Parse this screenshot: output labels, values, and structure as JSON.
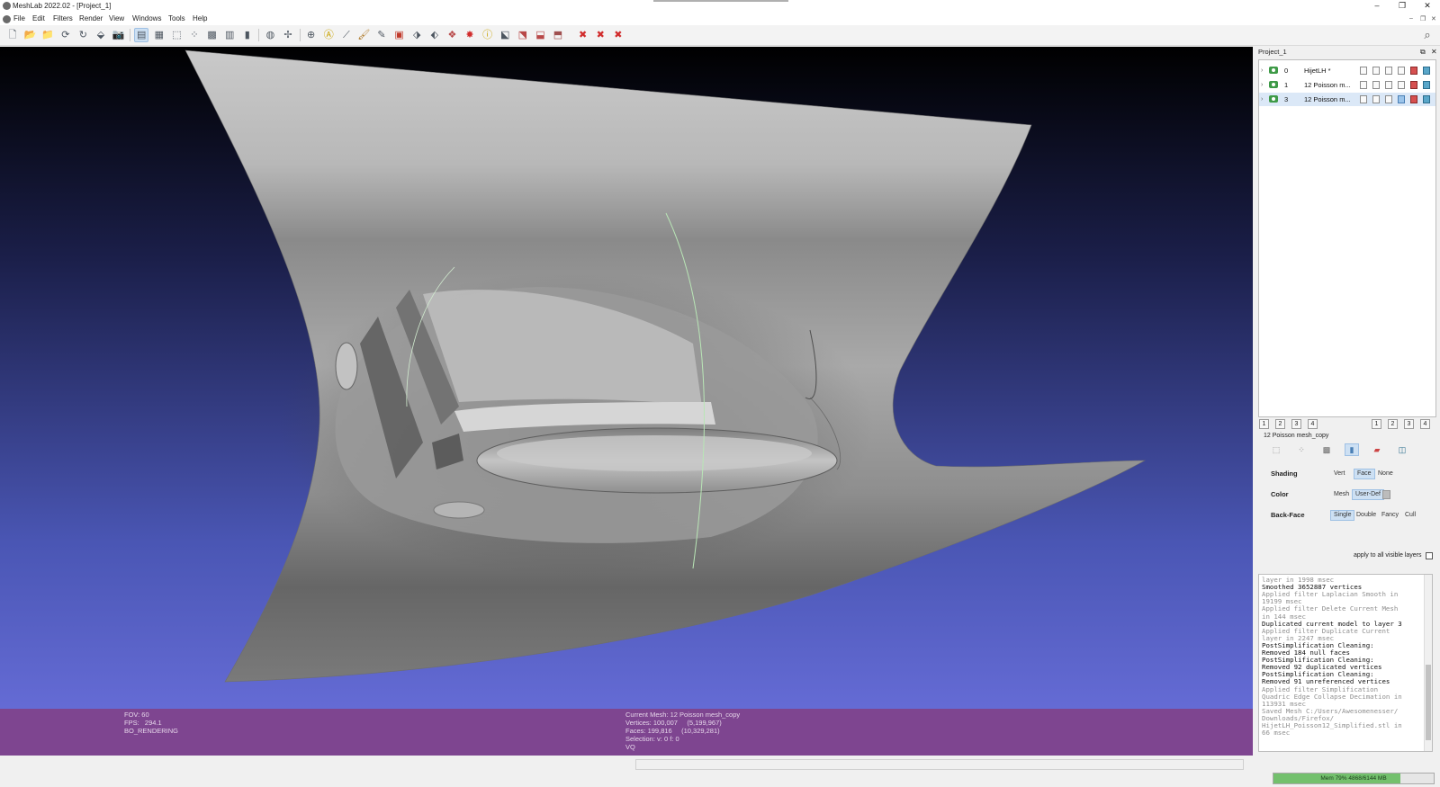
{
  "window": {
    "title": "MeshLab 2022.02 - [Project_1]",
    "controls": [
      "–",
      "❐",
      "✕"
    ]
  },
  "menu": [
    "File",
    "Edit",
    "Filters",
    "Render",
    "View",
    "Windows",
    "Tools",
    "Help"
  ],
  "toolbar": {
    "buttons": [
      {
        "name": "new-project-icon",
        "glyph": "🗋",
        "active": false
      },
      {
        "name": "open-project-icon",
        "glyph": "📂",
        "active": false
      },
      {
        "name": "import-mesh-icon",
        "glyph": "📁",
        "active": false
      },
      {
        "name": "reload-icon",
        "glyph": "⟳",
        "active": false
      },
      {
        "name": "reload-all-icon",
        "glyph": "↻",
        "active": false
      },
      {
        "name": "export-mesh-icon",
        "glyph": "⬙",
        "active": false
      },
      {
        "name": "snapshot-icon",
        "glyph": "📷",
        "active": false
      },
      {
        "name": "show-layers-icon",
        "glyph": "▤",
        "active": true
      },
      {
        "name": "raster-icon",
        "glyph": "▦",
        "active": false
      },
      {
        "name": "bbox-icon",
        "glyph": "⬚",
        "active": false
      },
      {
        "name": "points-icon",
        "glyph": "⁘",
        "active": false
      },
      {
        "name": "wireframe-icon",
        "glyph": "▩",
        "active": false
      },
      {
        "name": "flat-shading-icon",
        "glyph": "▥",
        "active": false
      },
      {
        "name": "smooth-shading-icon",
        "glyph": "▮",
        "active": false
      },
      {
        "name": "lighting-icon",
        "glyph": "◍",
        "active": false
      },
      {
        "name": "textures-icon",
        "glyph": "✢",
        "active": false
      },
      {
        "name": "manipulator-icon",
        "glyph": "⊕",
        "active": false
      },
      {
        "name": "annotate-icon",
        "glyph": "Ⓐ",
        "active": false
      },
      {
        "name": "measure-icon",
        "glyph": "⟋",
        "active": false
      },
      {
        "name": "paint-icon",
        "glyph": "🖌",
        "active": false
      },
      {
        "name": "z-paint-icon",
        "glyph": "✎",
        "active": false
      },
      {
        "name": "color-picker-icon",
        "glyph": "▣",
        "active": false
      },
      {
        "name": "select-vertices-icon",
        "glyph": "⬗",
        "active": false
      },
      {
        "name": "select-faces-icon",
        "glyph": "⬖",
        "active": false
      },
      {
        "name": "select-connected-icon",
        "glyph": "❖",
        "active": false
      },
      {
        "name": "align-icon",
        "glyph": "✸",
        "active": false
      },
      {
        "name": "info-icon",
        "glyph": "ⓘ",
        "active": false
      },
      {
        "name": "select-region-icon",
        "glyph": "⬕",
        "active": false
      },
      {
        "name": "select-color-icon",
        "glyph": "⬔",
        "active": false
      },
      {
        "name": "select-z-icon",
        "glyph": "⬓",
        "active": false
      },
      {
        "name": "select-pt-icon",
        "glyph": "⬒",
        "active": false
      },
      {
        "name": "delete-faces-icon",
        "glyph": "✖",
        "active": false
      },
      {
        "name": "delete-vertices-icon",
        "glyph": "✖",
        "active": false
      },
      {
        "name": "delete-selection-icon",
        "glyph": "✖",
        "active": false
      }
    ],
    "search_glyph": "⌕"
  },
  "colors": {
    "viewport_top": "#000000",
    "viewport_bottom": "#6c71de",
    "info_bar": "#7e4590",
    "mesh_light": "#c9c9c9",
    "mesh_dark": "#5c5c5c",
    "selection_highlight": "#cde0f3",
    "memory_fill": "#73c06d",
    "visible_eye": "#3e9a47"
  },
  "viewport": {
    "info_left": [
      "FOV: 60",
      "FPS:   294.1",
      "BO_RENDERING"
    ],
    "info_center": [
      "Current Mesh: 12 Poisson mesh_copy",
      "Vertices: 100,007     (5,199,967)",
      "Faces: 199,816     (10,329,281)",
      "Selection: v: 0 f: 0",
      "VQ"
    ]
  },
  "layers_panel": {
    "title": "Project_1",
    "header_controls": [
      "⧉",
      "✕"
    ],
    "layers": [
      {
        "id": "0",
        "name": "HijetLH *",
        "selected": false
      },
      {
        "id": "1",
        "name": "12 Poisson m...",
        "selected": false
      },
      {
        "id": "3",
        "name": "12 Poisson m...",
        "selected": true
      }
    ],
    "scene_buttons_left": [
      "1",
      "2",
      "3",
      "4"
    ],
    "scene_buttons_right": [
      "1",
      "2",
      "3",
      "4"
    ],
    "current_layer": "12 Poisson mesh_copy"
  },
  "render_options": {
    "shading": {
      "label": "Shading",
      "options": [
        "Vert",
        "Face",
        "None"
      ],
      "selected": "Face"
    },
    "color": {
      "label": "Color",
      "options": [
        "Mesh",
        "User-Def"
      ],
      "selected": "User-Def"
    },
    "backface": {
      "label": "Back-Face",
      "options": [
        "Single",
        "Double",
        "Fancy",
        "Cull"
      ],
      "selected": "Single"
    },
    "apply_all_label": "apply to all visible layers",
    "apply_all_checked": false
  },
  "log": [
    {
      "text": "layer in 1998 msec",
      "style": "gray"
    },
    {
      "text": "Smoothed 3652887 vertices",
      "style": "black"
    },
    {
      "text": "Applied filter Laplacian Smooth in",
      "style": "gray"
    },
    {
      "text": "19199 msec",
      "style": "gray"
    },
    {
      "text": "Applied filter Delete Current Mesh",
      "style": "gray"
    },
    {
      "text": "in 144 msec",
      "style": "gray"
    },
    {
      "text": "Duplicated current model to layer 3",
      "style": "black"
    },
    {
      "text": "Applied filter Duplicate Current",
      "style": "gray"
    },
    {
      "text": "layer in 2247 msec",
      "style": "gray"
    },
    {
      "text": "PostSimplification Cleaning:",
      "style": "black"
    },
    {
      "text": "Removed 184 null faces",
      "style": "black"
    },
    {
      "text": "PostSimplification Cleaning:",
      "style": "black"
    },
    {
      "text": "Removed 92 duplicated vertices",
      "style": "black"
    },
    {
      "text": "PostSimplification Cleaning:",
      "style": "black"
    },
    {
      "text": "Removed 91 unreferenced vertices",
      "style": "black"
    },
    {
      "text": "Applied filter Simplification",
      "style": "gray"
    },
    {
      "text": "Quadric Edge Collapse Decimation in",
      "style": "gray"
    },
    {
      "text": "113931 msec",
      "style": "gray"
    },
    {
      "text": "Saved Mesh C:/Users/Awesomenesser/",
      "style": "gray"
    },
    {
      "text": "Downloads/Firefox/",
      "style": "gray"
    },
    {
      "text": "HijetLH_Poisson12_Simplified.stl in",
      "style": "gray"
    },
    {
      "text": "66 msec",
      "style": "gray"
    }
  ],
  "memory": {
    "text": "Mem 79% 4868/6144 MB",
    "fraction": 0.79
  }
}
